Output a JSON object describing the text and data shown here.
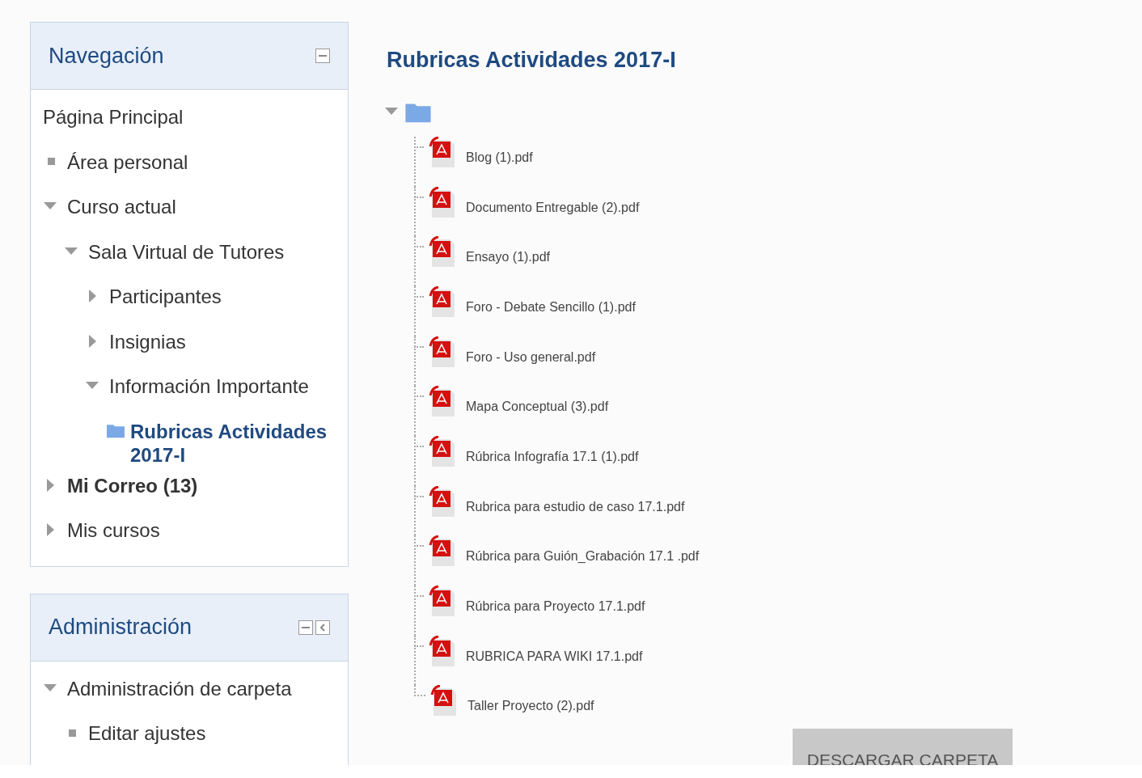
{
  "navigation": {
    "title": "Navegación",
    "items": [
      {
        "label": "Página Principal",
        "kind": "link",
        "bold": false,
        "selected": false
      },
      {
        "label": "Área personal",
        "kind": "leaf",
        "bold": false,
        "selected": false
      },
      {
        "label": "Curso actual",
        "kind": "branch",
        "expanded": true,
        "bold": false,
        "selected": false,
        "children": [
          {
            "label": "Sala Virtual de Tutores",
            "kind": "branch",
            "expanded": true,
            "bold": false,
            "selected": false,
            "children": [
              {
                "label": "Participantes",
                "kind": "branch",
                "expanded": false,
                "bold": false,
                "selected": false
              },
              {
                "label": "Insignias",
                "kind": "branch",
                "expanded": false,
                "bold": false,
                "selected": false
              },
              {
                "label": "Información Importante",
                "kind": "branch",
                "expanded": true,
                "bold": false,
                "selected": false,
                "children": [
                  {
                    "label": "Rubricas Actividades 2017-I",
                    "kind": "folder",
                    "bold": true,
                    "selected": true
                  }
                ]
              }
            ]
          }
        ]
      },
      {
        "label": "Mi Correo (13)",
        "kind": "branch",
        "expanded": false,
        "bold": true,
        "selected": false
      },
      {
        "label": "Mis cursos",
        "kind": "branch",
        "expanded": false,
        "bold": false,
        "selected": false
      }
    ]
  },
  "administration": {
    "title": "Administración",
    "items": [
      {
        "label": "Administración de carpeta",
        "kind": "branch",
        "expanded": true,
        "bold": false,
        "selected": false,
        "children": [
          {
            "label": "Editar ajustes",
            "kind": "leaf",
            "bold": false,
            "selected": false
          }
        ]
      }
    ]
  },
  "folder": {
    "title": "Rubricas Actividades 2017-I",
    "expanded": true,
    "files": [
      "Blog (1).pdf",
      "Documento Entregable (2).pdf",
      "Ensayo (1).pdf",
      "Foro - Debate Sencillo (1).pdf",
      "Foro - Uso general.pdf",
      "Mapa Conceptual (3).pdf",
      "Rúbrica Infografía 17.1 (1).pdf",
      "Rubrica para estudio de caso 17.1.pdf",
      "Rúbrica para Guión_Grabación 17.1 .pdf",
      "Rúbrica para Proyecto 17.1.pdf",
      "RUBRICA PARA WIKI 17.1.pdf",
      "Taller Proyecto (2).pdf"
    ],
    "download_button": "DESCARGAR CARPETA"
  }
}
